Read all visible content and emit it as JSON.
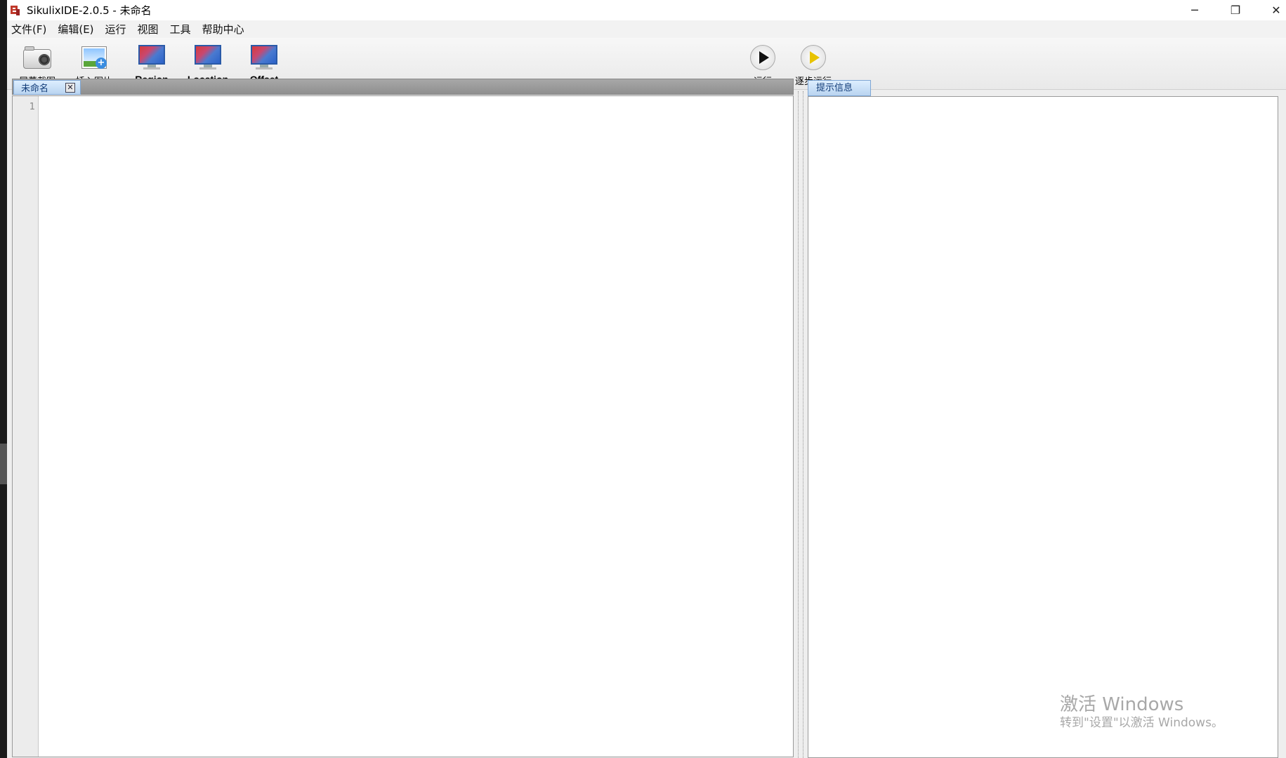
{
  "window": {
    "title": "SikulixIDE-2.0.5 - 未命名",
    "controls": [
      "─",
      "❐",
      "✕"
    ]
  },
  "menu": [
    "文件(F)",
    "编辑(E)",
    "运行",
    "视图",
    "工具",
    "帮助中心"
  ],
  "toolbar": {
    "screenshot": "屏幕截图",
    "insert_image": "插入图片",
    "region": "Region",
    "location": "Location",
    "offset": "Offset",
    "run": "运行",
    "step_run": "逐步运行"
  },
  "editor": {
    "tab_label": "未命名",
    "close_glyph": "✕",
    "line_numbers": [
      "1"
    ]
  },
  "hint_panel": {
    "tab_label": "提示信息"
  },
  "activation": {
    "title": "激活 Windows",
    "subtitle": "转到\"设置\"以激活 Windows。"
  }
}
